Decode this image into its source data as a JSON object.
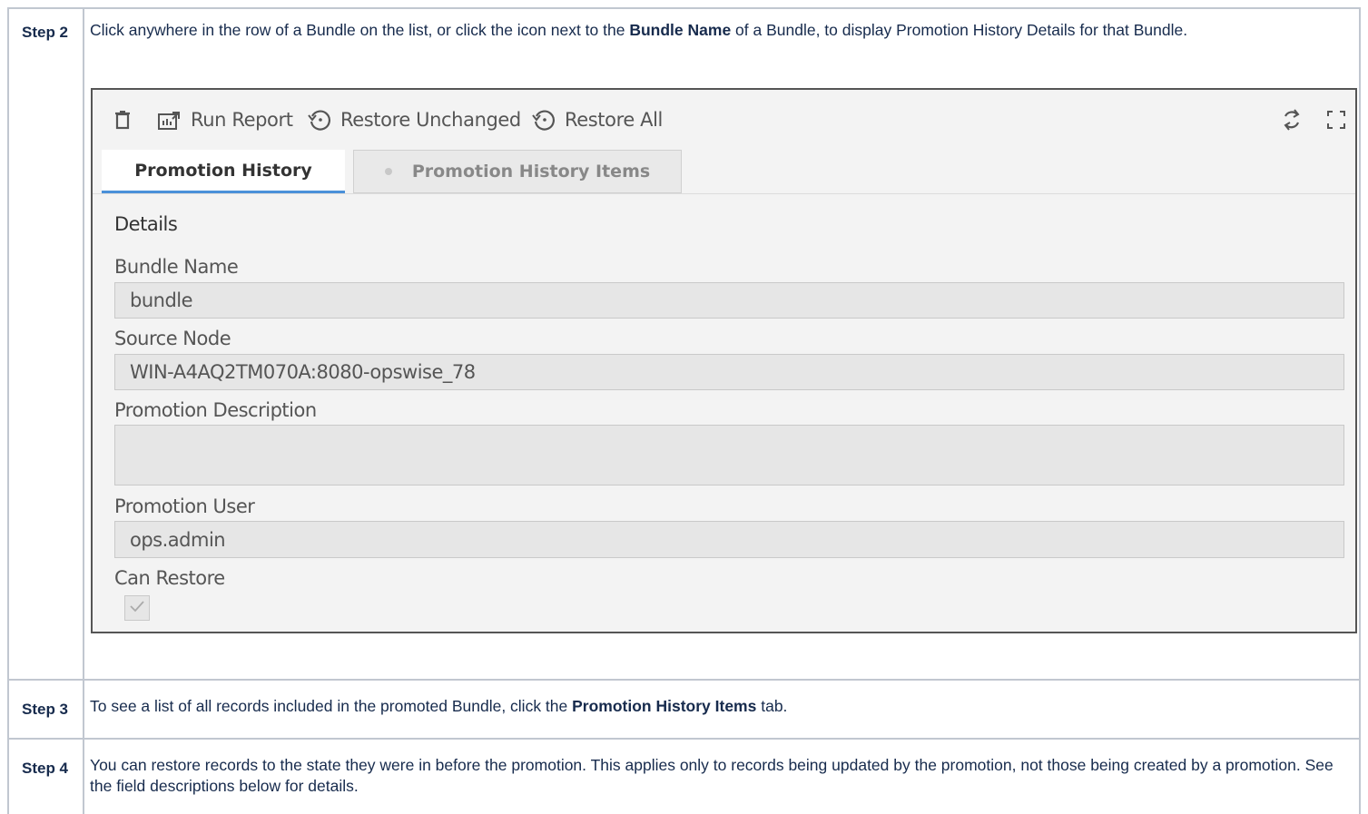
{
  "steps": [
    {
      "label": "Step 2",
      "text_pre": "Click anywhere in the row of a Bundle on the list, or click the icon next to the ",
      "text_bold": "Bundle Name",
      "text_post": " of a Bundle, to display Promotion History Details for that Bundle."
    },
    {
      "label": "Step 3",
      "text_pre": "To see a list of all records included in the promoted Bundle, click the ",
      "text_bold": "Promotion History Items",
      "text_post": " tab."
    },
    {
      "label": "Step 4",
      "text": "You can restore records to the state they were in before the promotion. This applies only to records being updated by the promotion, not those being created by a promotion. See the field descriptions below for details."
    }
  ],
  "toolbar": {
    "delete_icon": "trash-icon",
    "run_report_label": "Run Report",
    "restore_unchanged_label": "Restore Unchanged",
    "restore_all_label": "Restore All",
    "refresh_icon": "refresh-icon",
    "fullscreen_icon": "expand-icon"
  },
  "tabs": {
    "active": "Promotion History",
    "inactive": "Promotion History Items"
  },
  "details": {
    "title": "Details",
    "bundle_name_label": "Bundle Name",
    "bundle_name_value": "bundle",
    "source_node_label": "Source Node",
    "source_node_value": "WIN-A4AQ2TM070A:8080-opswise_78",
    "promotion_description_label": "Promotion Description",
    "promotion_description_value": "",
    "promotion_user_label": "Promotion User",
    "promotion_user_value": "ops.admin",
    "can_restore_label": "Can Restore",
    "can_restore_checked": true
  },
  "colors": {
    "tab_accent": "#4a90d9",
    "border": "#c1c7d0"
  }
}
